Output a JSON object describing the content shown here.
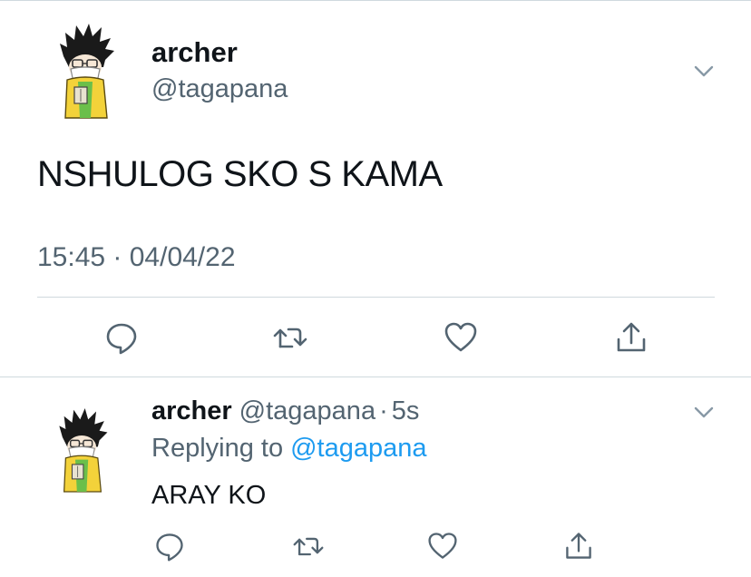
{
  "main_tweet": {
    "author_name": "archer",
    "author_handle": "@tagapana",
    "text": "NSHULOG SKO S KAMA",
    "timestamp": "15:45 · 04/04/22",
    "avatar": "cartoon-avatar-masked-character",
    "menu_icon": "chevron-down-icon",
    "actions": [
      "reply-icon",
      "retweet-icon",
      "like-icon",
      "share-icon"
    ]
  },
  "reply_tweet": {
    "author_name": "archer",
    "author_handle": "@tagapana",
    "separator": "·",
    "time": "5s",
    "replying_to_label": "Replying to",
    "replying_to_handle": "@tagapana",
    "text": "ARAY KO",
    "avatar": "cartoon-avatar-masked-character",
    "menu_icon": "chevron-down-icon",
    "actions": [
      "reply-icon",
      "retweet-icon",
      "like-icon",
      "share-icon"
    ]
  },
  "colors": {
    "text_primary": "#0f1419",
    "text_secondary": "#536471",
    "link": "#1d9bf0",
    "divider": "#cfd9de"
  }
}
